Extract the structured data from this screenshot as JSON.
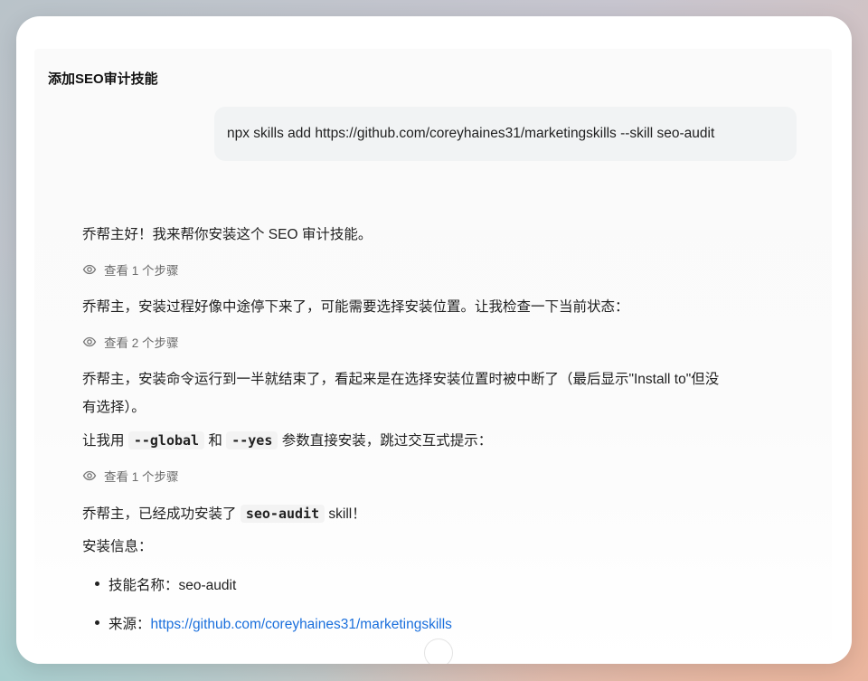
{
  "chat": {
    "title": "添加SEO审计技能",
    "user_message": "npx skills add https://github.com/coreyhaines31/marketingskills --skill seo-audit",
    "messages": {
      "m1": "乔帮主好！我来帮你安装这个 SEO 审计技能。",
      "steps1": "查看 1 个步骤",
      "m2": "乔帮主，安装过程好像中途停下来了，可能需要选择安装位置。让我检查一下当前状态：",
      "steps2": "查看 2 个步骤",
      "m3_line1": "乔帮主，安装命令运行到一半就结束了，看起来是在选择安装位置时被中断了（最后显示\"Install to\"但没",
      "m3_line2": "有选择）。",
      "m4_prefix": "让我用",
      "m4_code1": "--global",
      "m4_mid": "和",
      "m4_code2": "--yes",
      "m4_suffix": "参数直接安装，跳过交互式提示：",
      "steps3": "查看 1 个步骤",
      "m5_prefix": "乔帮主，已经成功安装了",
      "m5_code": "seo-audit",
      "m5_suffix": "skill！",
      "m6": "安装信息：",
      "bullet1": "技能名称：seo-audit",
      "bullet2_label": "来源：",
      "bullet2_link": "https://github.com/coreyhaines31/marketingskills"
    }
  },
  "colors": {
    "link": "#1a6fdc",
    "bubble": "#f1f3f4"
  },
  "icons": {
    "steps": "eye-icon"
  }
}
